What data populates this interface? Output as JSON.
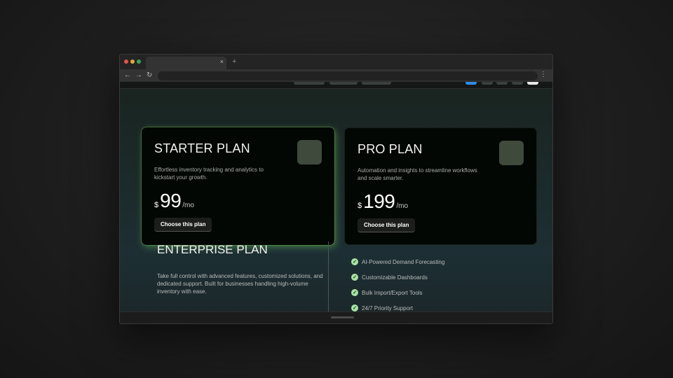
{
  "browser": {
    "new_tab_label": "+",
    "tab_close_label": "×",
    "nav": {
      "back": "←",
      "forward": "→",
      "reload": "↻",
      "menu": "⋮"
    }
  },
  "plans": [
    {
      "title": "STARTER PLAN",
      "description": "Effortless inventory tracking and analytics to kickstart your growth.",
      "currency": "$",
      "price": "99",
      "period": "/mo",
      "cta": "Choose this plan"
    },
    {
      "title": "PRO PLAN",
      "description": "Automation and insights to streamline workflows and scale smarter.",
      "currency": "$",
      "price": "199",
      "period": "/mo",
      "cta": "Choose this plan"
    }
  ],
  "enterprise": {
    "title": "ENTERPRISE PLAN",
    "description": "Take full control with advanced features, customized solutions, and dedicated support. Built for businesses handling high-volume inventory with ease.",
    "check_glyph": "✓",
    "features": [
      "AI-Powered Demand Forecasting",
      "Customizable Dashboards",
      "Bulk Import/Export Tools",
      "24/7 Priority Support"
    ]
  },
  "colors": {
    "accent_glow": "#78d25a",
    "check_fill": "#a6e3a3",
    "nav_blue": "#2d8ee8"
  }
}
